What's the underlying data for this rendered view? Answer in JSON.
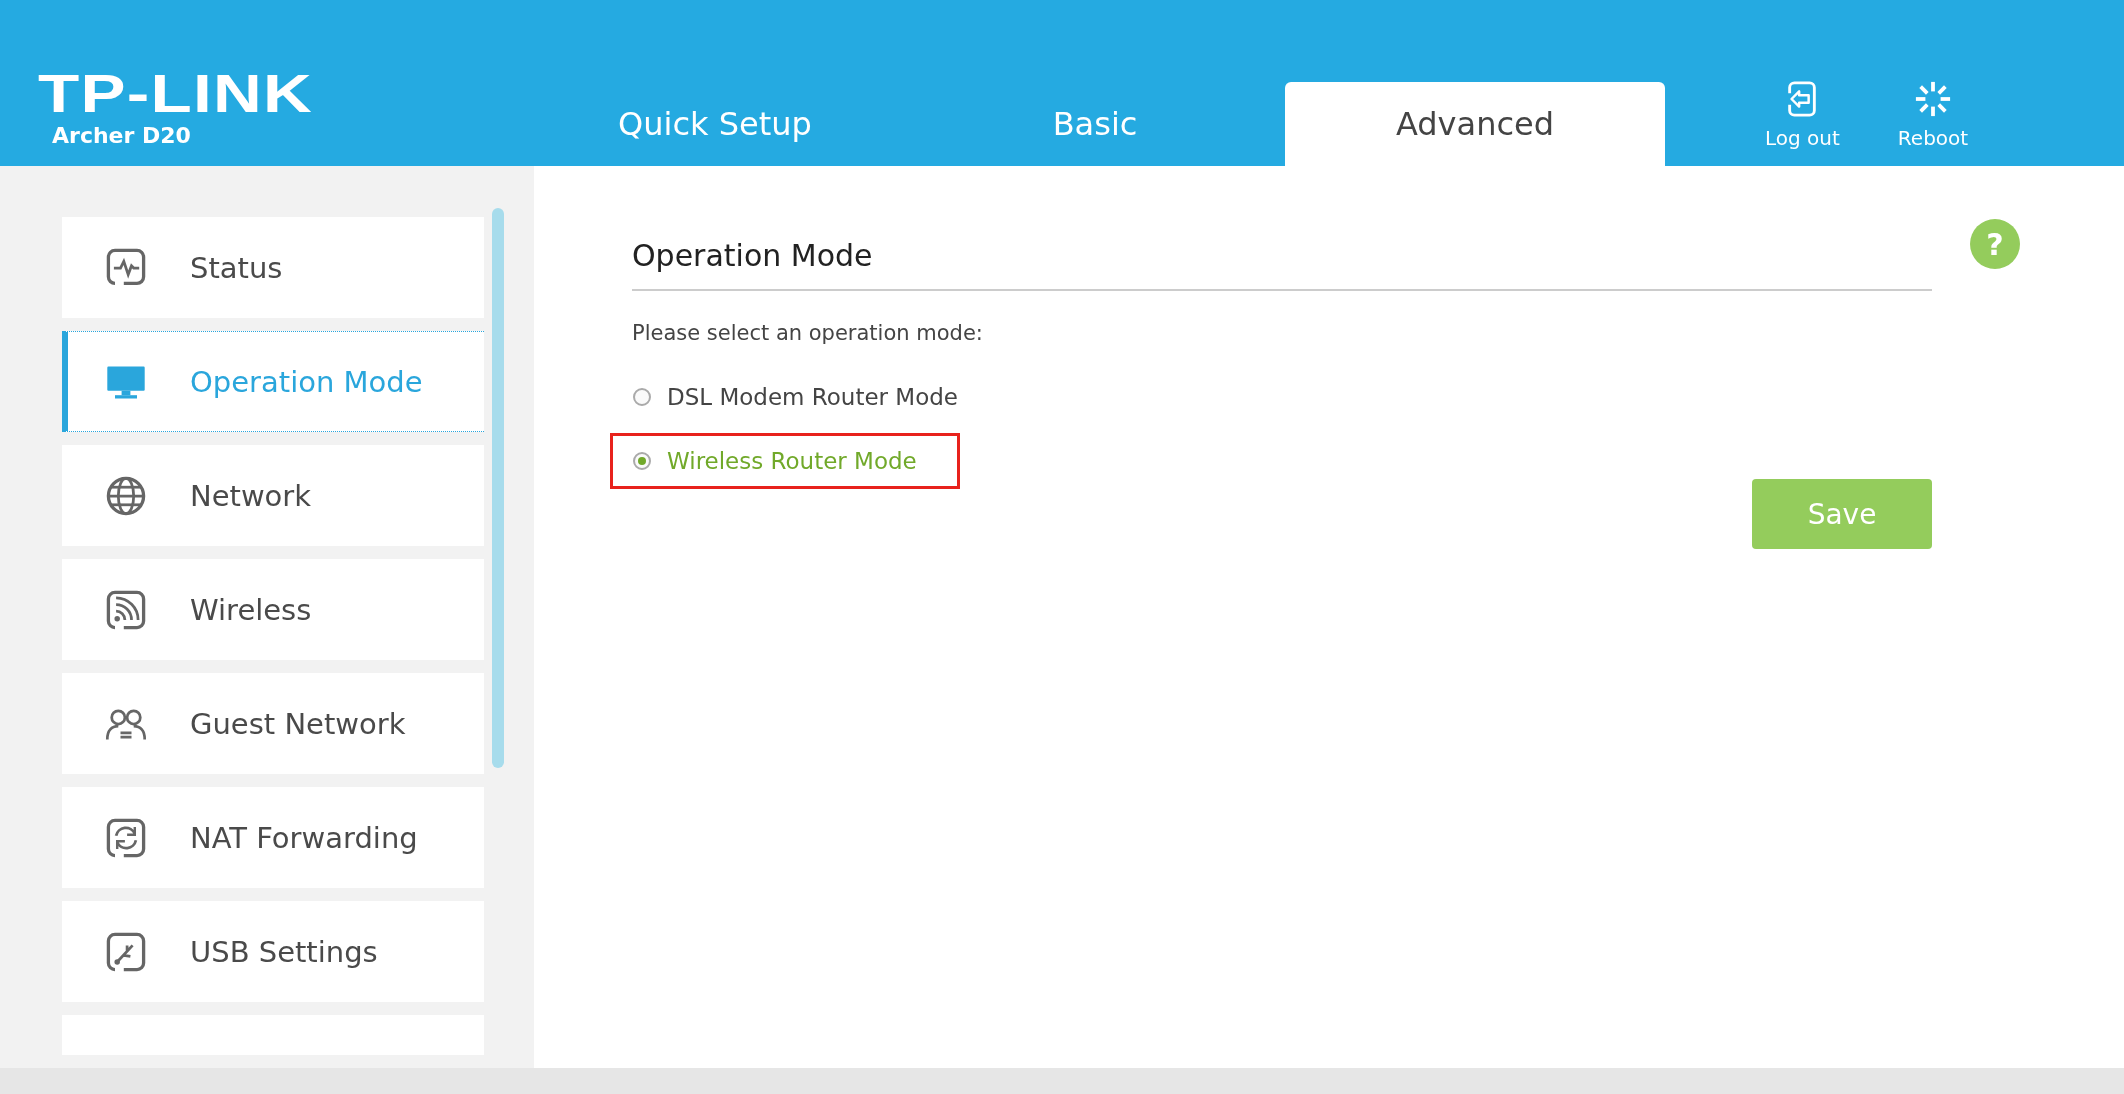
{
  "header": {
    "logo": "TP-LINK",
    "model": "Archer D20"
  },
  "tabs": [
    {
      "label": "Quick Setup",
      "selected": false
    },
    {
      "label": "Basic",
      "selected": false
    },
    {
      "label": "Advanced",
      "selected": true
    }
  ],
  "actions": [
    {
      "label": "Log out"
    },
    {
      "label": "Reboot"
    }
  ],
  "sidebar": {
    "items": [
      {
        "label": "Status",
        "selected": false
      },
      {
        "label": "Operation Mode",
        "selected": true
      },
      {
        "label": "Network",
        "selected": false
      },
      {
        "label": "Wireless",
        "selected": false
      },
      {
        "label": "Guest Network",
        "selected": false
      },
      {
        "label": "NAT Forwarding",
        "selected": false
      },
      {
        "label": "USB Settings",
        "selected": false
      }
    ]
  },
  "content": {
    "title": "Operation Mode",
    "prompt": "Please select an operation mode:",
    "options": [
      {
        "label": "DSL Modem Router Mode",
        "selected": false,
        "highlighted": false
      },
      {
        "label": "Wireless Router Mode",
        "selected": true,
        "highlighted": true
      }
    ],
    "save_button": "Save",
    "help": "?"
  }
}
